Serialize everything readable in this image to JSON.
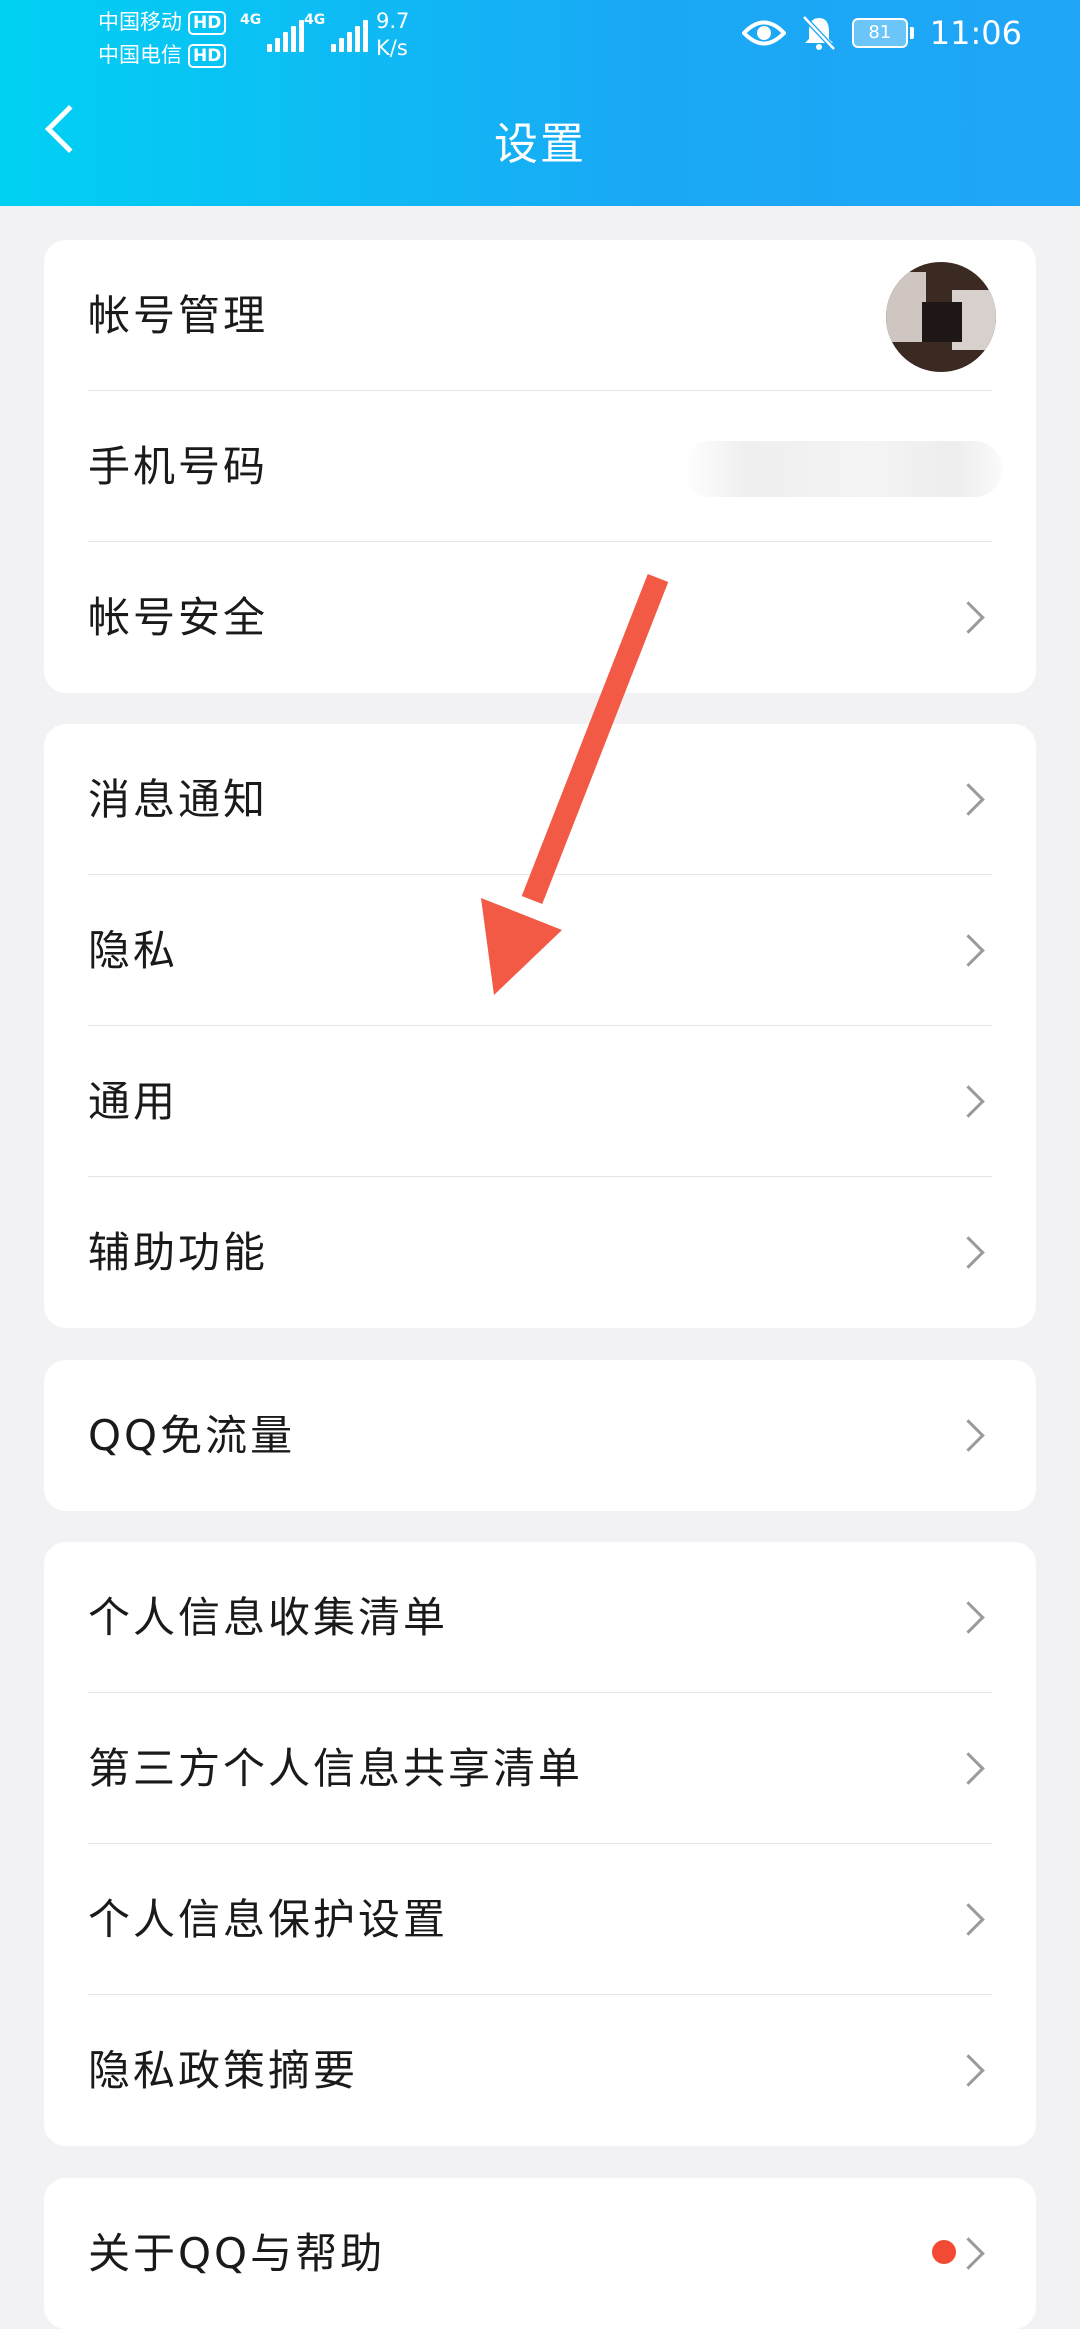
{
  "status_bar": {
    "carrier1": "中国移动",
    "carrier2": "中国电信",
    "hd_badge": "HD",
    "network_type": "4G",
    "speed_value": "9.7",
    "speed_unit": "K/s",
    "battery": "81",
    "time": "11:06",
    "icons": [
      "eye-icon",
      "bell-off-icon",
      "battery-icon"
    ]
  },
  "header": {
    "title": "设置",
    "back_icon": "chevron-left-icon",
    "background_colors": [
      "#00d1f3",
      "#20a6f6"
    ]
  },
  "groups": [
    {
      "items": [
        {
          "label": "帐号管理",
          "trailing": "avatar"
        },
        {
          "label": "手机号码",
          "trailing": "masked-value"
        },
        {
          "label": "帐号安全",
          "trailing": "chevron"
        }
      ]
    },
    {
      "items": [
        {
          "label": "消息通知",
          "trailing": "chevron"
        },
        {
          "label": "隐私",
          "trailing": "chevron"
        },
        {
          "label": "通用",
          "trailing": "chevron"
        },
        {
          "label": "辅助功能",
          "trailing": "chevron"
        }
      ]
    },
    {
      "items": [
        {
          "label": "QQ免流量",
          "trailing": "chevron"
        }
      ]
    },
    {
      "items": [
        {
          "label": "个人信息收集清单",
          "trailing": "chevron"
        },
        {
          "label": "第三方个人信息共享清单",
          "trailing": "chevron"
        },
        {
          "label": "个人信息保护设置",
          "trailing": "chevron"
        },
        {
          "label": "隐私政策摘要",
          "trailing": "chevron"
        }
      ]
    },
    {
      "items": [
        {
          "label": "关于QQ与帮助",
          "trailing": "red-dot-chevron"
        }
      ]
    }
  ],
  "annotation": {
    "type": "arrow",
    "color": "#f25a45"
  },
  "colors": {
    "page_bg": "#f2f2f5",
    "card_bg": "#ffffff",
    "badge_red": "#f34a33"
  }
}
